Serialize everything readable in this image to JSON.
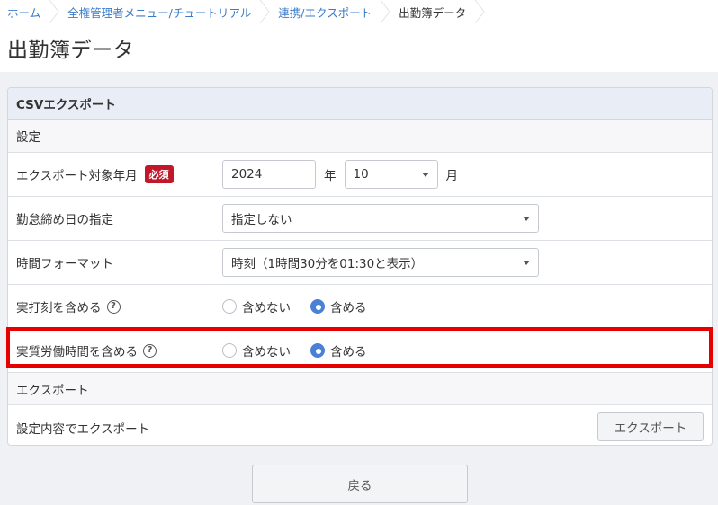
{
  "breadcrumb": [
    {
      "label": "ホーム",
      "link": true
    },
    {
      "label": "全権管理者メニュー/チュートリアル",
      "link": true
    },
    {
      "label": "連携/エクスポート",
      "link": true
    },
    {
      "label": "出勤簿データ",
      "link": false
    }
  ],
  "page": {
    "title": "出勤簿データ"
  },
  "panel": {
    "heading": "CSVエクスポート",
    "settings_section": "設定",
    "export_section": "エクスポート"
  },
  "form": {
    "target_month": {
      "label": "エクスポート対象年月",
      "required_badge": "必須",
      "year_value": "2024",
      "year_unit": "年",
      "month_value": "10",
      "month_unit": "月"
    },
    "closing_day": {
      "label": "勤怠締め日の指定",
      "value": "指定しない"
    },
    "time_format": {
      "label": "時間フォーマット",
      "value": "時刻（1時間30分を01:30と表示）"
    },
    "include_actual_punch": {
      "label": "実打刻を含める",
      "help": "?",
      "options": [
        "含めない",
        "含める"
      ],
      "selected": "含める"
    },
    "include_actual_work": {
      "label": "実質労働時間を含める",
      "help": "?",
      "options": [
        "含めない",
        "含める"
      ],
      "selected": "含める"
    }
  },
  "export": {
    "label": "設定内容でエクスポート",
    "button": "エクスポート"
  },
  "footer": {
    "back_button": "戻る"
  },
  "colors": {
    "accent": "#4a80d6",
    "required": "#c0172b",
    "highlight": "#e60000",
    "link": "#3a7bc8"
  }
}
